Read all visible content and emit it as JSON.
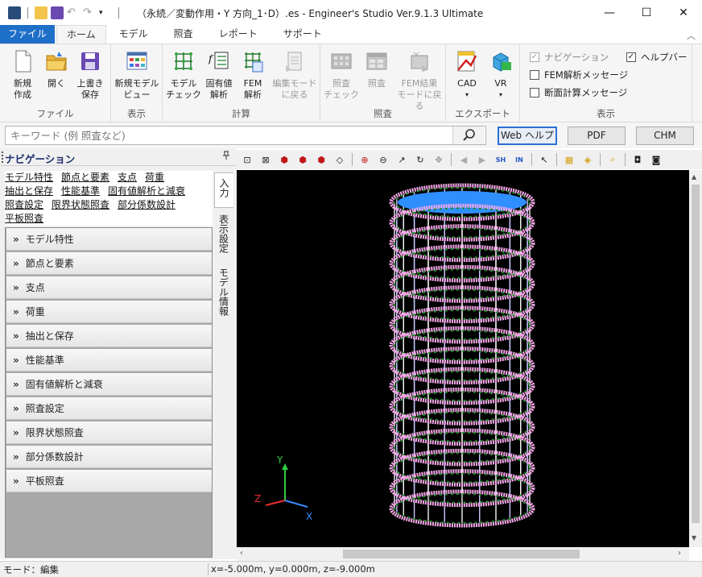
{
  "window": {
    "title": "（永続／変動作用・Y 方向_1･D）.es - Engineer's Studio Ver.9.1.3 Ultimate"
  },
  "tabs": [
    "ファイル",
    "ホーム",
    "モデル",
    "照査",
    "レポート",
    "サポート"
  ],
  "active_tab": "ホーム",
  "ribbon": {
    "groups": {
      "file": "ファイル",
      "display": "表示",
      "calc": "計算",
      "check": "照査",
      "export": "エクスポート",
      "display2": "表示"
    },
    "buttons": {
      "new": "新規\n作成",
      "open": "開く",
      "overwrite": "上書き\n保存",
      "new_model_view": "新規モデル\nビュー",
      "model_check": "モデル\nチェック",
      "eigen": "固有値\n解析",
      "fem": "FEM\n解析",
      "back_to_edit": "編集モード\nに戻る",
      "check_check": "照査\nチェック",
      "check": "照査",
      "back_fem": "FEM結果\nモードに戻る",
      "cad": "CAD",
      "vr": "VR"
    },
    "checks": {
      "navigation": "ナビゲーション",
      "help_bar": "ヘルプバー",
      "fem_message": "FEM解析メッセージ",
      "section_message": "断面計算メッセージ"
    }
  },
  "search": {
    "placeholder": "キーワード (例 照査など)",
    "web_help": "Web ヘルプ",
    "pdf": "PDF",
    "chm": "CHM"
  },
  "nav": {
    "title": "ナビゲーション",
    "pin": "ᐃ",
    "links": [
      "モデル特性",
      "節点と要素",
      "支点",
      "荷重",
      "抽出と保存",
      "性能基準",
      "固有値解析と減衰",
      "照査設定",
      "限界状態照査",
      "部分係数設計",
      "平板照査"
    ],
    "items": [
      "モデル特性",
      "節点と要素",
      "支点",
      "荷重",
      "抽出と保存",
      "性能基準",
      "固有値解析と減衰",
      "照査設定",
      "限界状態照査",
      "部分係数設計",
      "平板照査"
    ],
    "chevron": "»",
    "vtabs": [
      "入力",
      "表示設定",
      "モデル情報"
    ]
  },
  "axes": {
    "x": "X",
    "y": "Y",
    "z": "Z"
  },
  "status": {
    "mode": "モード：編集",
    "coords": "x=-5.000m, y=0.000m, z=-9.000m"
  },
  "colors": {
    "file_tab": "#1e6fc8",
    "viewport_bg": "#000000",
    "model_pink": "#f4a6e6",
    "model_green": "#1f8a2a",
    "model_blue": "#2f8fff"
  }
}
